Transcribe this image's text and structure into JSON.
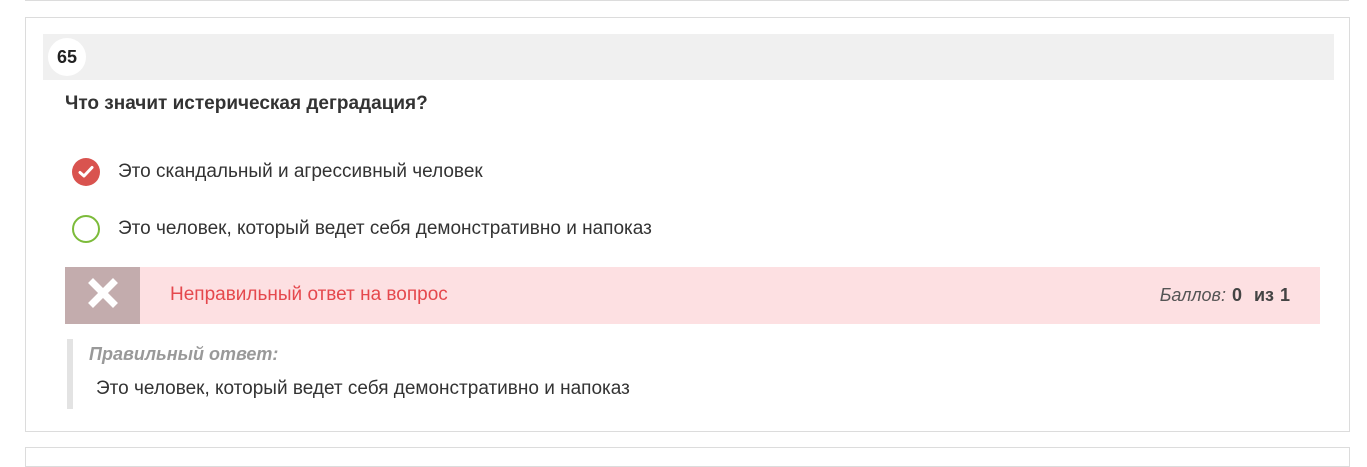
{
  "question": {
    "number": "65",
    "text": "Что значит истерическая деградация?"
  },
  "options": [
    {
      "label": "Это скандальный и агрессивный человек",
      "selected": true
    },
    {
      "label": "Это человек, который ведет себя демонстративно и напоказ",
      "selected": false
    }
  ],
  "feedback": {
    "message": "Неправильный ответ на вопрос",
    "score_label": "Баллов:",
    "score_value": "0",
    "score_of": "из",
    "score_max": "1"
  },
  "correct": {
    "title": "Правильный ответ:",
    "answer": "Это человек, который ведет себя демонстративно и напоказ"
  },
  "colors": {
    "selected_wrong": "#d9534f",
    "correct_outline": "#7cbb3a",
    "error_text": "#e5484d",
    "error_bg": "#fde0e2"
  },
  "icons": {
    "selected": "check-icon",
    "wrong": "cross-icon"
  }
}
